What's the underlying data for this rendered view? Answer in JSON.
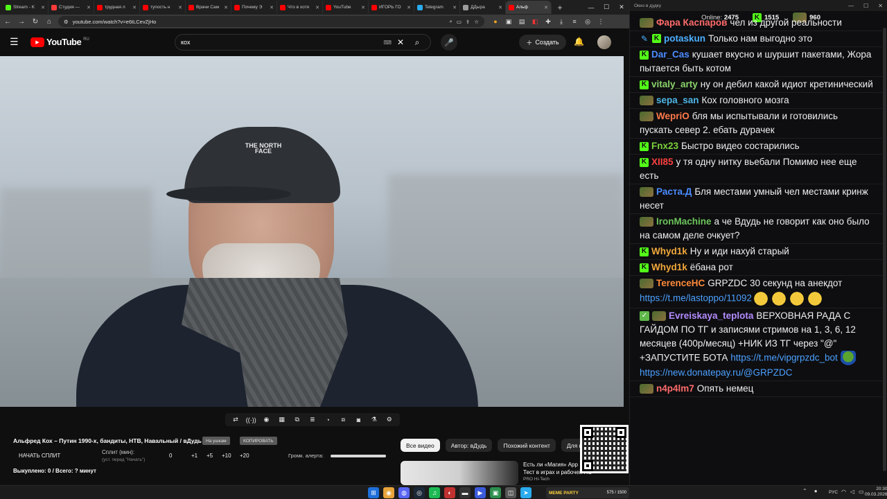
{
  "browser": {
    "tabs": [
      {
        "title": "Stream - K",
        "color": "#53fc18"
      },
      {
        "title": "Студия —",
        "color": "#ff3b3b"
      },
      {
        "title": "трудная л",
        "color": "#ff0000"
      },
      {
        "title": "тупость н",
        "color": "#ff0000"
      },
      {
        "title": "Врачи Сам",
        "color": "#ff0000"
      },
      {
        "title": "Почему Э",
        "color": "#ff0000"
      },
      {
        "title": "Что в хотя",
        "color": "#ff0000"
      },
      {
        "title": "YouTube",
        "color": "#ff0000"
      },
      {
        "title": "ИГОРЬ ГО",
        "color": "#ff0000"
      },
      {
        "title": "Telegram",
        "color": "#2aabee"
      },
      {
        "title": "ДДыра",
        "color": "#9c9c9c"
      },
      {
        "title": "Альф",
        "color": "#ff0000"
      }
    ],
    "url": "youtube.com/watch?v=e6tLCevZjHo"
  },
  "youtube": {
    "logo_text": "YouTube",
    "region": "RU",
    "search_query": "кох",
    "create_label": "Создать",
    "video_title": "Альфред Кох – Путин 1990-х, бандиты, НТВ, Навальный / вДудь",
    "cap_logo": "THE NORTH FACE",
    "pill_1": "На ушкам",
    "pill_2": "КОПИРОВАТЬ",
    "split": {
      "button": "НАЧАТЬ СПЛИТ",
      "label": "Сплит (мин):",
      "sublabel": "(уст. перед \"Начать\")",
      "value": "0",
      "increments": [
        "+1",
        "+5",
        "+10",
        "+20"
      ],
      "alert_label": "Громк. алерта:",
      "alert_level": 1.0
    },
    "progress_text": "Выкуплено: 0 / Всего: ? минут",
    "chips": [
      "Все видео",
      "Автор: вДудь",
      "Похожий контент",
      "Для в"
    ],
    "rec": {
      "line1": "Есть ли «Магия» Арр",
      "line2": "Тест в играх и рабочей ПО",
      "line3": "PRO Hi-Tech"
    }
  },
  "chat": {
    "window_title": "Окно в дудку",
    "online_label": "Online:",
    "online_count": "2475",
    "kick_count": "1515",
    "frog_count": "960",
    "messages": [
      {
        "badges": [
          "frog"
        ],
        "user": "Фара Каспаров",
        "color": "#ff6b6b",
        "text": "чел из другой реальности"
      },
      {
        "badges": [
          "wrench",
          "kick"
        ],
        "user": "potaskun",
        "color": "#4cb0ff",
        "text": "Только нам выгодно это"
      },
      {
        "badges": [
          "kick"
        ],
        "user": "Dar_Cas",
        "color": "#4b8cff",
        "text": "кушает вкусно и шуршит пакетами, Жора пытается быть котом"
      },
      {
        "badges": [
          "kick"
        ],
        "user": "vitaly_arty",
        "color": "#8bd36a",
        "text": "ну он дебил какой идиот кретинический"
      },
      {
        "badges": [
          "frog"
        ],
        "user": "sepa_san",
        "color": "#4fb7e8",
        "text": "Кох головного мозга"
      },
      {
        "badges": [
          "frog"
        ],
        "user": "WepriO",
        "color": "#ff7a4a",
        "text": "бля мы испытывали и готовились пускать север 2. ебать дурачек"
      },
      {
        "badges": [
          "kick"
        ],
        "user": "Fnx23",
        "color": "#7bd13c",
        "text": "Быстро видео состарились"
      },
      {
        "badges": [
          "kick"
        ],
        "user": "XII85",
        "color": "#ff4040",
        "text": "у тя одну нитку вьебали Помимо нее еще есть"
      },
      {
        "badges": [
          "frog"
        ],
        "user": "Раста.Д",
        "color": "#4b8cff",
        "text": "Бля местами умный чел местами кринж несет"
      },
      {
        "badges": [
          "frog"
        ],
        "user": "IronMachine",
        "color": "#6bc45a",
        "text": "а че Вдудь не говорит как оно было на самом деле очкует?"
      },
      {
        "badges": [
          "kick"
        ],
        "user": "Whyd1k",
        "color": "#f2a83a",
        "text": "Ну и иди нахуй старый"
      },
      {
        "badges": [
          "kick"
        ],
        "user": "Whyd1k",
        "color": "#f2a83a",
        "text": "ёбана рот"
      },
      {
        "badges": [
          "frog"
        ],
        "user": "TerenceHC",
        "color": "#ff8a3a",
        "text": "GRPZDC 30 секунд на анекдот",
        "link": "https://t.me/lastoppo/11092",
        "emotes": 4
      },
      {
        "badges": [
          "check",
          "frog"
        ],
        "user": "Evreiskaya_teplota",
        "color": "#b48cff",
        "text": "ВЕРХОВНАЯ РАДА С ГАЙДОМ ПО ТГ и записями стримов на 1, 3, 6, 12 месяцев (400р/месяц) +НИК ИЗ ТГ через \"@\" +ЗАПУСТИТЕ БОТА",
        "link": "https://t.me/vipgrpzdc_bot",
        "link2": "https://new.donatepay.ru/@GRPZDC"
      },
      {
        "badges": [
          "frog"
        ],
        "user": "n4p4lm7",
        "color": "#ff6b6b",
        "text": "Опять немец"
      }
    ]
  },
  "taskbar": {
    "widget_label": "MEME PARTY",
    "widget_count": "575 / 1500",
    "lang": "РУС",
    "time": "20:30",
    "date": "09.03.2026"
  }
}
